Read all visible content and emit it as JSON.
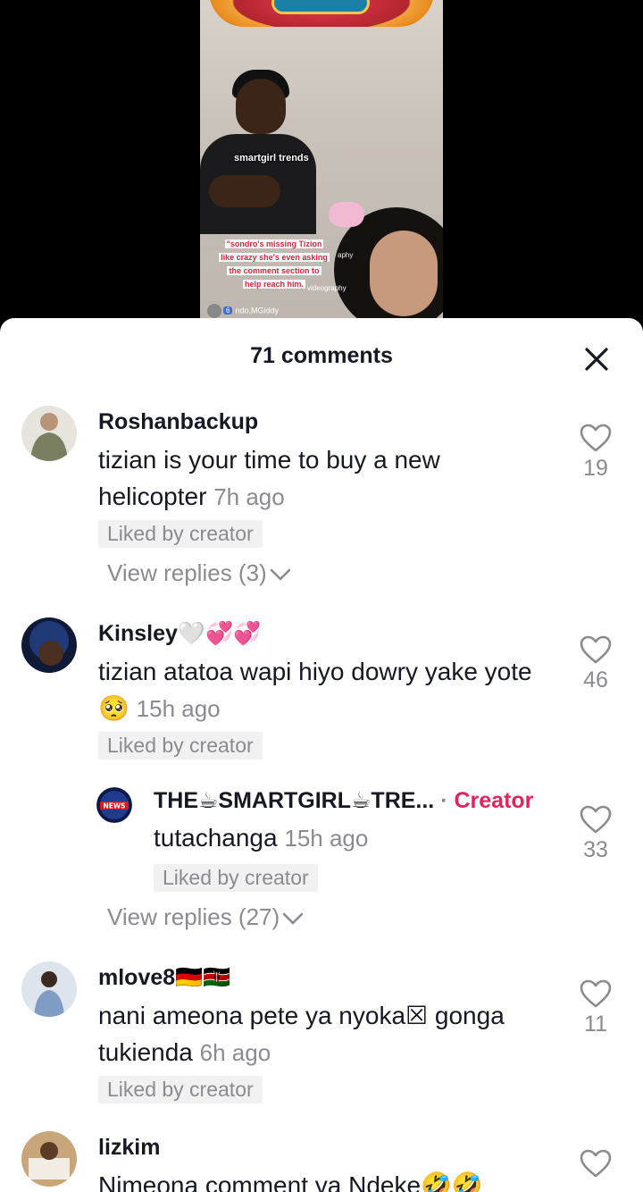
{
  "video": {
    "overlay_tag": "smartgirl trends",
    "caption_lines": [
      "\"sondro's missing Tizion",
      "like crazy she's even asking",
      "the comment section to",
      "help reach him."
    ],
    "caption_side": "aphy",
    "caption_side2": "videography",
    "bottom_badge": "6",
    "bottom_user": "ndo,MGiddy"
  },
  "header": {
    "title": "71 comments",
    "close_icon": "close-icon"
  },
  "comments": [
    {
      "username": "Roshanbackup",
      "text": "tizian is your time to buy a new helicopter",
      "time": "7h ago",
      "liked_label": "Liked by creator",
      "likes": "19",
      "view_replies": "View replies (3)",
      "avatar_color": "#8a8f7a"
    },
    {
      "username": "Kinsley🤍💞💞",
      "text": "tizian atatoa wapi hiyo dowry yake yote🥺",
      "time": "15h ago",
      "liked_label": "Liked by creator",
      "likes": "46",
      "avatar_color": "#20304f",
      "reply": {
        "username": "THE☕SMARTGIRL☕TRE...",
        "separator": "·",
        "creator_label": "Creator",
        "text": "tutachanga",
        "time": "15h ago",
        "liked_label": "Liked by creator",
        "likes": "33"
      },
      "view_replies": "View replies (27)"
    },
    {
      "username": "mlove8🇩🇪🇰🇪",
      "text": "nani ameona pete ya nyoka☒ gonga tukienda",
      "time": "6h ago",
      "liked_label": "Liked by creator",
      "likes": "11",
      "avatar_color": "#6f87a6"
    },
    {
      "username": "lizkim",
      "text": "Nimeona comment ya Ndeke🤣🤣",
      "likes": "",
      "avatar_color": "#8c6a45"
    }
  ],
  "colors": {
    "creator": "#e0245e",
    "secondary_text": "#8a8b91",
    "primary_text": "#161823",
    "liked_bg": "#f1f1f2"
  }
}
